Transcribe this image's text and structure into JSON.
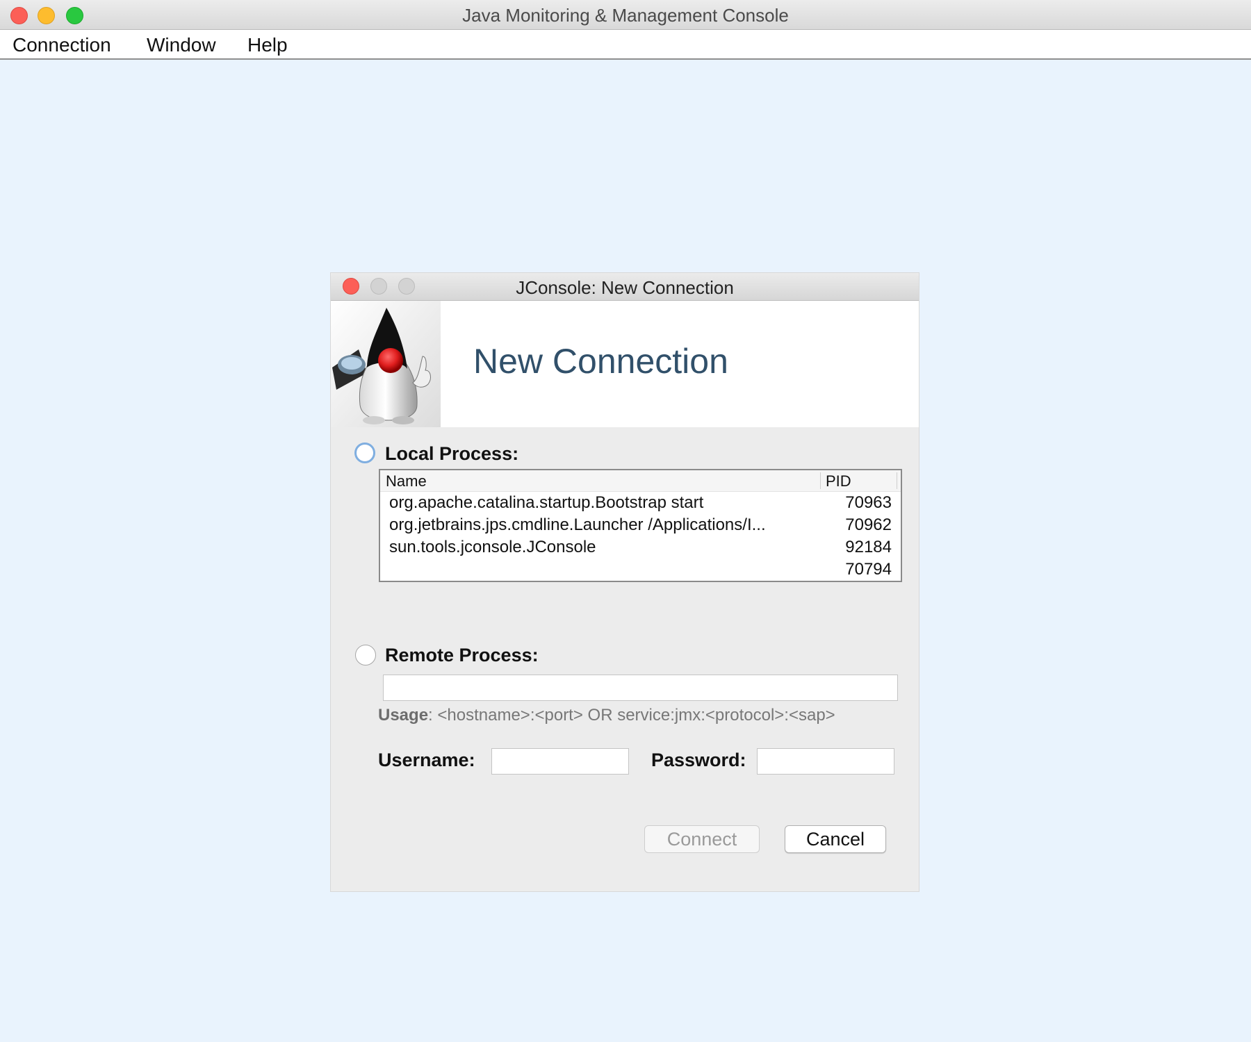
{
  "window": {
    "title": "Java Monitoring & Management Console"
  },
  "menubar": {
    "items": [
      "Connection",
      "Window",
      "Help"
    ]
  },
  "dialog": {
    "title": "JConsole: New Connection",
    "heading": "New Connection",
    "local": {
      "label": "Local Process:",
      "columns": {
        "name": "Name",
        "pid": "PID"
      },
      "rows": [
        {
          "name": "org.apache.catalina.startup.Bootstrap start",
          "pid": "70963"
        },
        {
          "name": "org.jetbrains.jps.cmdline.Launcher /Applications/I...",
          "pid": "70962"
        },
        {
          "name": "sun.tools.jconsole.JConsole",
          "pid": "92184"
        },
        {
          "name": "",
          "pid": "70794"
        }
      ]
    },
    "remote": {
      "label": "Remote Process:",
      "value": "",
      "usage_label": "Usage",
      "usage_text": ": <hostname>:<port> OR service:jmx:<protocol>:<sap>"
    },
    "credentials": {
      "username_label": "Username:",
      "username_value": "",
      "password_label": "Password:",
      "password_value": ""
    },
    "buttons": {
      "connect": "Connect",
      "cancel": "Cancel"
    }
  },
  "colors": {
    "desktop_bg": "#e9f3fd",
    "heading": "#31506a",
    "close": "#fc5f57",
    "minimize": "#fdbc2e",
    "zoom": "#29c840"
  },
  "icons": {
    "logo": "duke-mascot-icon"
  }
}
